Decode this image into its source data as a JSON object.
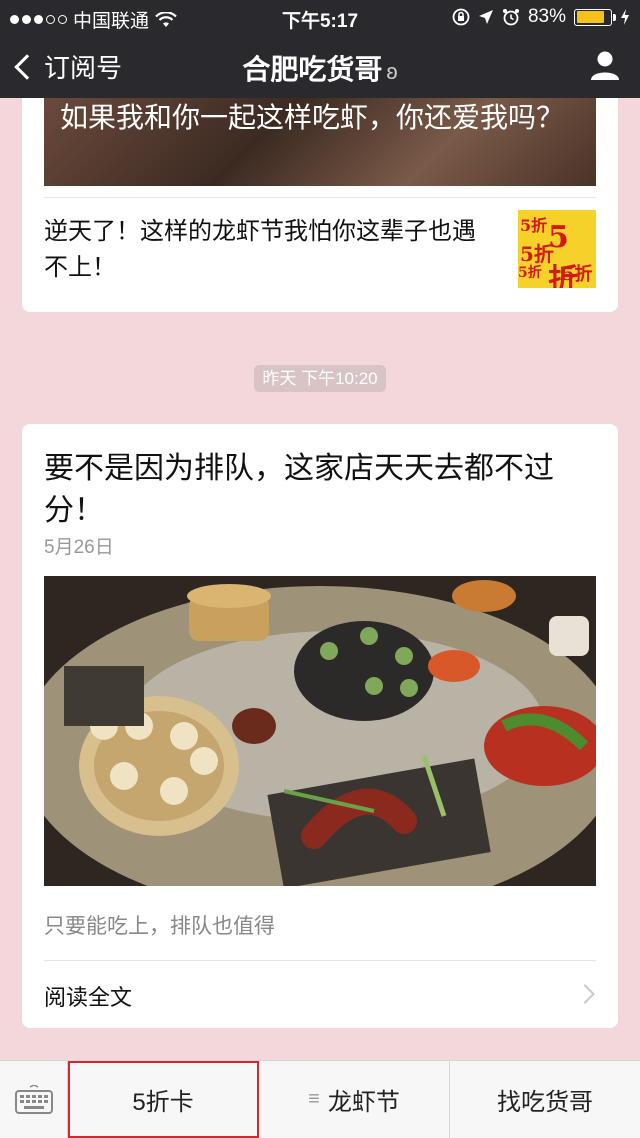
{
  "status": {
    "carrier": "中国联通",
    "time": "下午5:17",
    "battery": "83%",
    "battery_level": 0.83
  },
  "nav": {
    "back_label": "订阅号",
    "title": "合肥吃货哥"
  },
  "card1": {
    "hero_caption": "如果我和你一起这样吃虾，你还爱我吗？",
    "item_title": "逆天了！这样的龙虾节我怕你这辈子也遇不上！",
    "thumb_text": [
      "5折",
      "5折",
      "5折",
      "5折",
      "5折"
    ]
  },
  "timestamp": "昨天 下午10:20",
  "card2": {
    "headline": "要不是因为排队，这家店天天去都不过分！",
    "date": "5月26日",
    "description": "只要能吃上，排队也值得",
    "read_more": "阅读全文"
  },
  "menu": {
    "items": [
      "5折卡",
      "龙虾节",
      "找吃货哥"
    ],
    "menu_icon": "≡"
  },
  "colors": {
    "nav_bg": "#2a2a2e",
    "page_bg": "#f3d7da",
    "highlight": "#d9252b",
    "battery": "#f4c21b"
  }
}
